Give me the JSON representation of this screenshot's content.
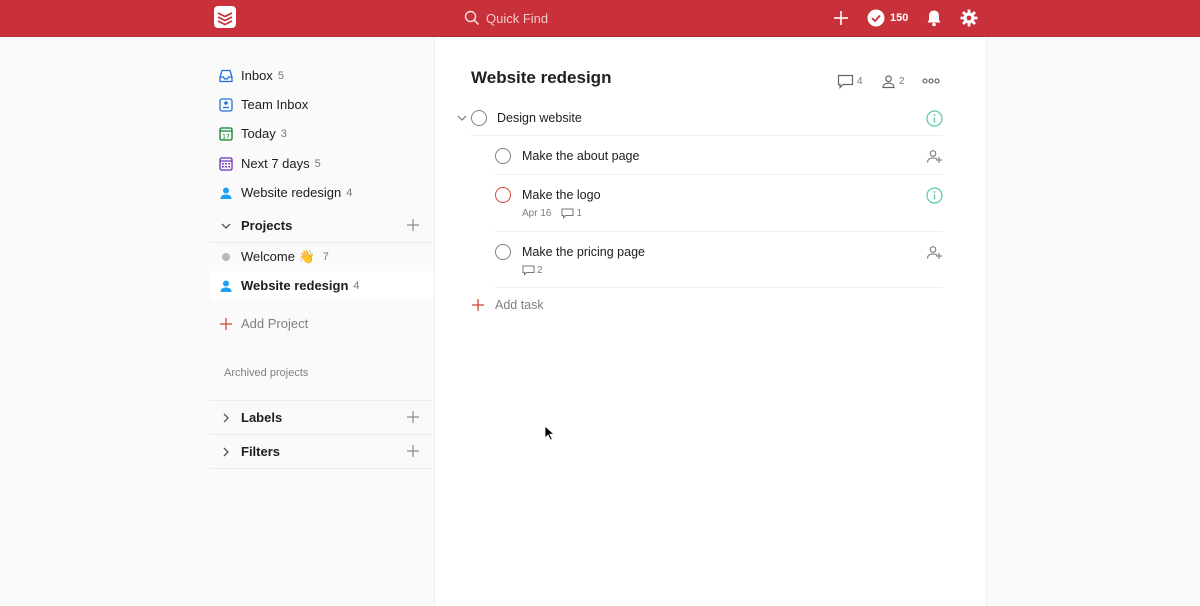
{
  "topbar": {
    "search_placeholder": "Quick Find",
    "karma_count": "150"
  },
  "sidebar": {
    "nav": [
      {
        "label": "Inbox",
        "count": "5",
        "icon": "inbox-icon"
      },
      {
        "label": "Team Inbox",
        "count": "",
        "icon": "team-inbox-icon"
      },
      {
        "label": "Today",
        "count": "3",
        "icon": "calendar-today-icon"
      },
      {
        "label": "Next 7 days",
        "count": "5",
        "icon": "calendar-week-icon"
      },
      {
        "label": "Website redesign",
        "count": "4",
        "icon": "person-icon"
      }
    ],
    "projects_heading": "Projects",
    "projects": [
      {
        "label": "Welcome 👋",
        "count": "7"
      },
      {
        "label": "Website redesign",
        "count": "4"
      }
    ],
    "add_project": "Add Project",
    "archived": "Archived projects",
    "labels_heading": "Labels",
    "filters_heading": "Filters"
  },
  "main": {
    "title": "Website redesign",
    "comments_count": "4",
    "members_count": "2",
    "tasks": [
      {
        "content": "Design website"
      },
      {
        "content": "Make the about page"
      },
      {
        "content": "Make the logo",
        "date": "Apr 16",
        "comments": "1"
      },
      {
        "content": "Make the pricing page",
        "comments": "2"
      }
    ],
    "add_task": "Add task"
  },
  "colors": {
    "brand": "#c8303a",
    "priority_red": "#d1453b",
    "info_green": "#58c8a7",
    "person_blue": "#1da1f2"
  }
}
